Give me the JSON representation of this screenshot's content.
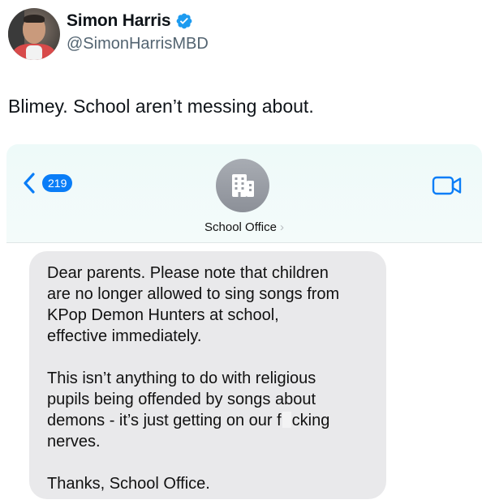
{
  "author": {
    "display_name": "Simon Harris",
    "handle": "@SimonHarrisMBD",
    "verified_icon": "verified-badge-icon",
    "verified_color": "#1d9bf0"
  },
  "tweet": {
    "text": "Blimey. School aren’t messing about."
  },
  "screenshot": {
    "back_badge": "219",
    "contact_name": "School Office",
    "contact_chevron": "›",
    "accent_color": "#0a7df7",
    "message": {
      "p1_lines": [
        "Dear parents. Please note that children",
        "are no longer allowed to sing songs from",
        "KPop Demon Hunters at school,",
        "effective immediately."
      ],
      "p2_lines": [
        "This isn’t anything to do with religious",
        "pupils being offended by songs about",
        "demons - it’s just getting on our f",
        "cking",
        "nerves."
      ],
      "p3_lines": [
        "Thanks, School Office."
      ]
    }
  }
}
